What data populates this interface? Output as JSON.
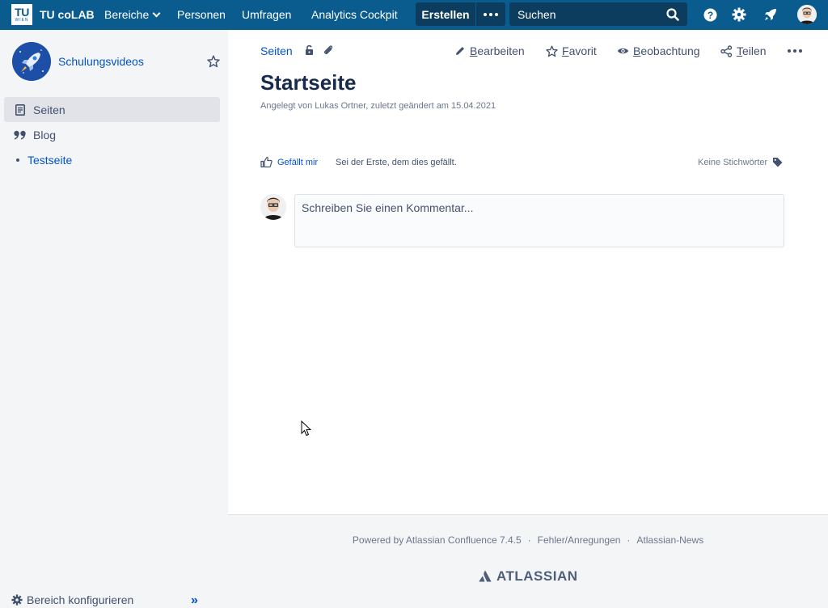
{
  "topnav": {
    "logo_line1": "TU",
    "logo_line2": "WIEN",
    "brand": "TU coLAB",
    "items": [
      {
        "label": "Bereiche"
      },
      {
        "label": "Personen"
      },
      {
        "label": "Umfragen"
      },
      {
        "label": "Analytics Cockpit"
      }
    ],
    "create_label": "Erstellen",
    "search_placeholder": "Suchen",
    "icons": [
      "more-dots-icon",
      "search-icon",
      "help-icon",
      "gear-icon",
      "rocket-icon",
      "user-avatar"
    ]
  },
  "sidebar": {
    "space_name": "Schulungsvideos",
    "nav": [
      {
        "label": "Seiten",
        "icon": "page-icon"
      },
      {
        "label": "Blog",
        "icon": "quote-icon"
      }
    ],
    "tree": [
      {
        "label": "Testseite"
      }
    ],
    "configure_label": "Bereich konfigurieren",
    "collapse_label": "»"
  },
  "page": {
    "breadcrumb": "Seiten",
    "actions": {
      "edit_first": "B",
      "edit_rest": "earbeiten",
      "fav_first": "F",
      "fav_rest": "avorit",
      "watch_first": "B",
      "watch_rest": "eobachtung",
      "share_first": "T",
      "share_rest": "eilen"
    },
    "title": "Startseite",
    "byline": "Angelegt von Lukas Ortner, zuletzt geändert am 15.04.2021",
    "like_label": "Gefällt mir",
    "like_text": "Sei der Erste, dem dies gefällt.",
    "labels_text": "Keine Stichwörter",
    "comment_placeholder": "Schreiben Sie einen Kommentar..."
  },
  "footer": {
    "powered": "Powered by Atlassian Confluence 7.4.5",
    "feedback": "Fehler/Anregungen",
    "news": "Atlassian-News",
    "separator": "·",
    "brand": "ATLASSIAN"
  },
  "colors": {
    "topnav_bg": "#0a5c8f",
    "topnav_dark": "#0d3d5e",
    "link": "#0052cc",
    "sidebar_bg": "#f4f5f7"
  }
}
